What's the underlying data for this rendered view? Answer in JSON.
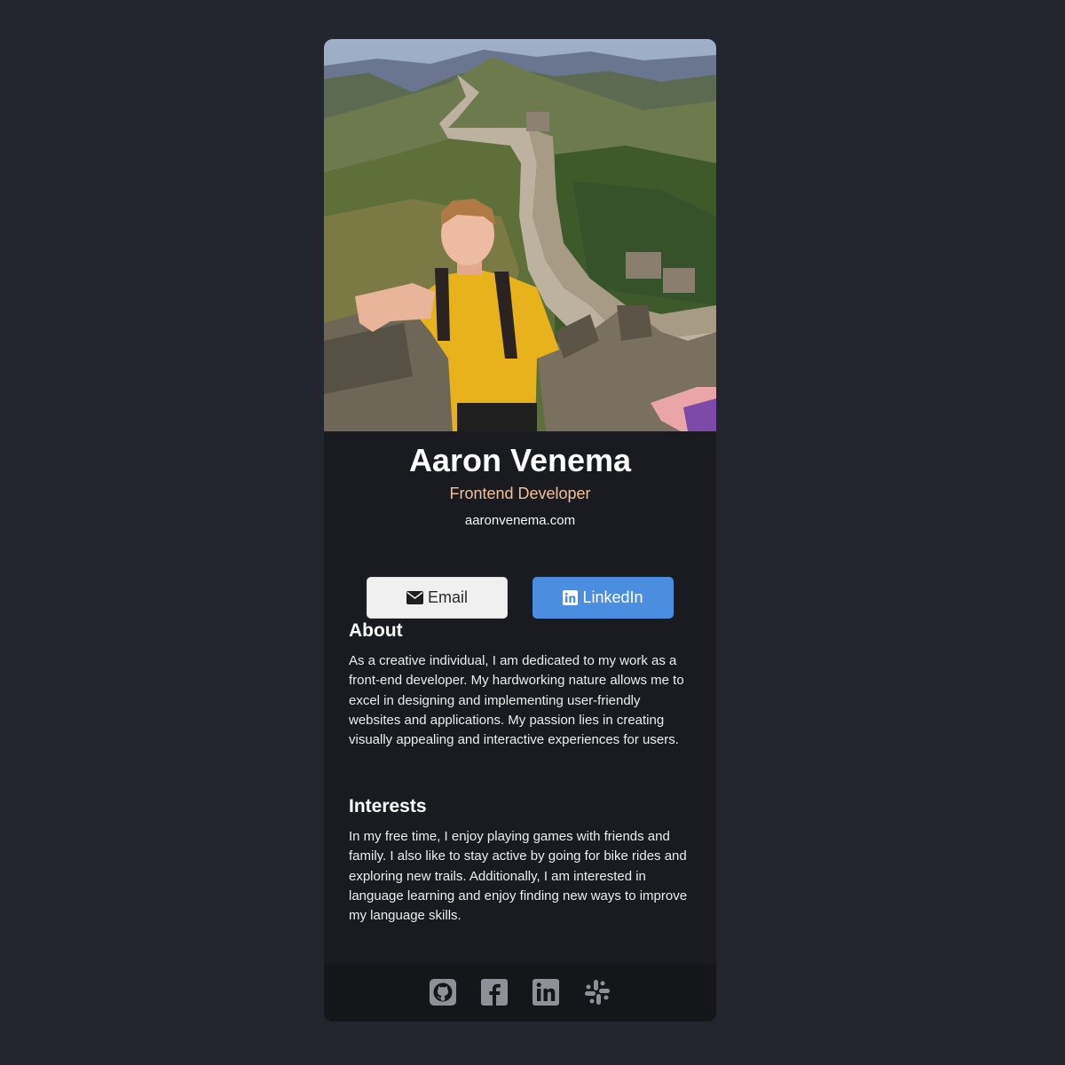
{
  "profile": {
    "name": "Aaron Venema",
    "role": "Frontend Developer",
    "website": "aaronvenema.com",
    "photo_alt": "Aaron Venema"
  },
  "buttons": {
    "email_label": "Email",
    "email_icon": "envelope-icon",
    "linkedin_label": "LinkedIn",
    "linkedin_icon": "linkedin-icon"
  },
  "about": {
    "heading": "About",
    "text": "As a creative individual, I am dedicated to my work as a front-end developer. My hardworking nature allows me to excel in designing and implementing user-friendly websites and applications. My passion lies in creating visually appealing and interactive experiences for users."
  },
  "interests": {
    "heading": "Interests",
    "text": "In my free time, I enjoy playing games with friends and family. I also like to stay active by going for bike rides and exploring new trails. Additionally, I am interested in language learning and enjoy finding new ways to improve my language skills."
  },
  "footer": {
    "icons": [
      "github-icon",
      "facebook-icon",
      "linkedin-icon",
      "slack-icon"
    ]
  },
  "colors": {
    "page_background": "#23252f",
    "card_background": "#1a1b20",
    "footer_background": "#15161a",
    "accent_role": "#f3bf99",
    "linkedin_blue": "#4b8ee0",
    "footer_icon": "#8f9098"
  }
}
